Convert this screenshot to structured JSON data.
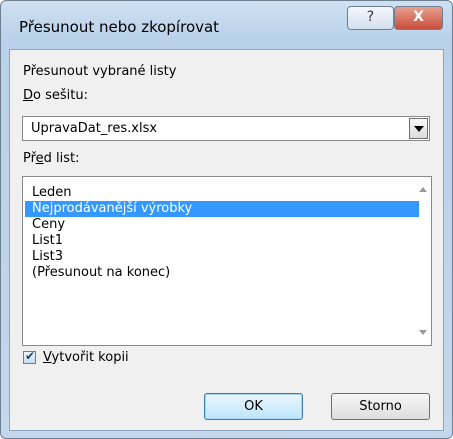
{
  "window": {
    "title": "Přesunout nebo zkopírovat",
    "help_icon": "?",
    "close_icon": "X"
  },
  "dialog": {
    "section_title": "Přesunout vybrané listy",
    "workbook_label_first": "D",
    "workbook_label_rest": "o sešitu:",
    "workbook_value": "UpravaDat_res.xlsx",
    "before_label_first": "Př",
    "before_label_ul": "e",
    "before_label_rest": "d list:",
    "sheets": [
      "Leden",
      "Nejprodávanější výrobky",
      "Ceny",
      "List1",
      "List3",
      "(Přesunout na konec)"
    ],
    "selected_sheet_index": 1,
    "copy_label_first": "V",
    "copy_label_rest": "ytvořit kopii",
    "copy_checked": true,
    "ok_label": "OK",
    "cancel_label": "Storno"
  }
}
